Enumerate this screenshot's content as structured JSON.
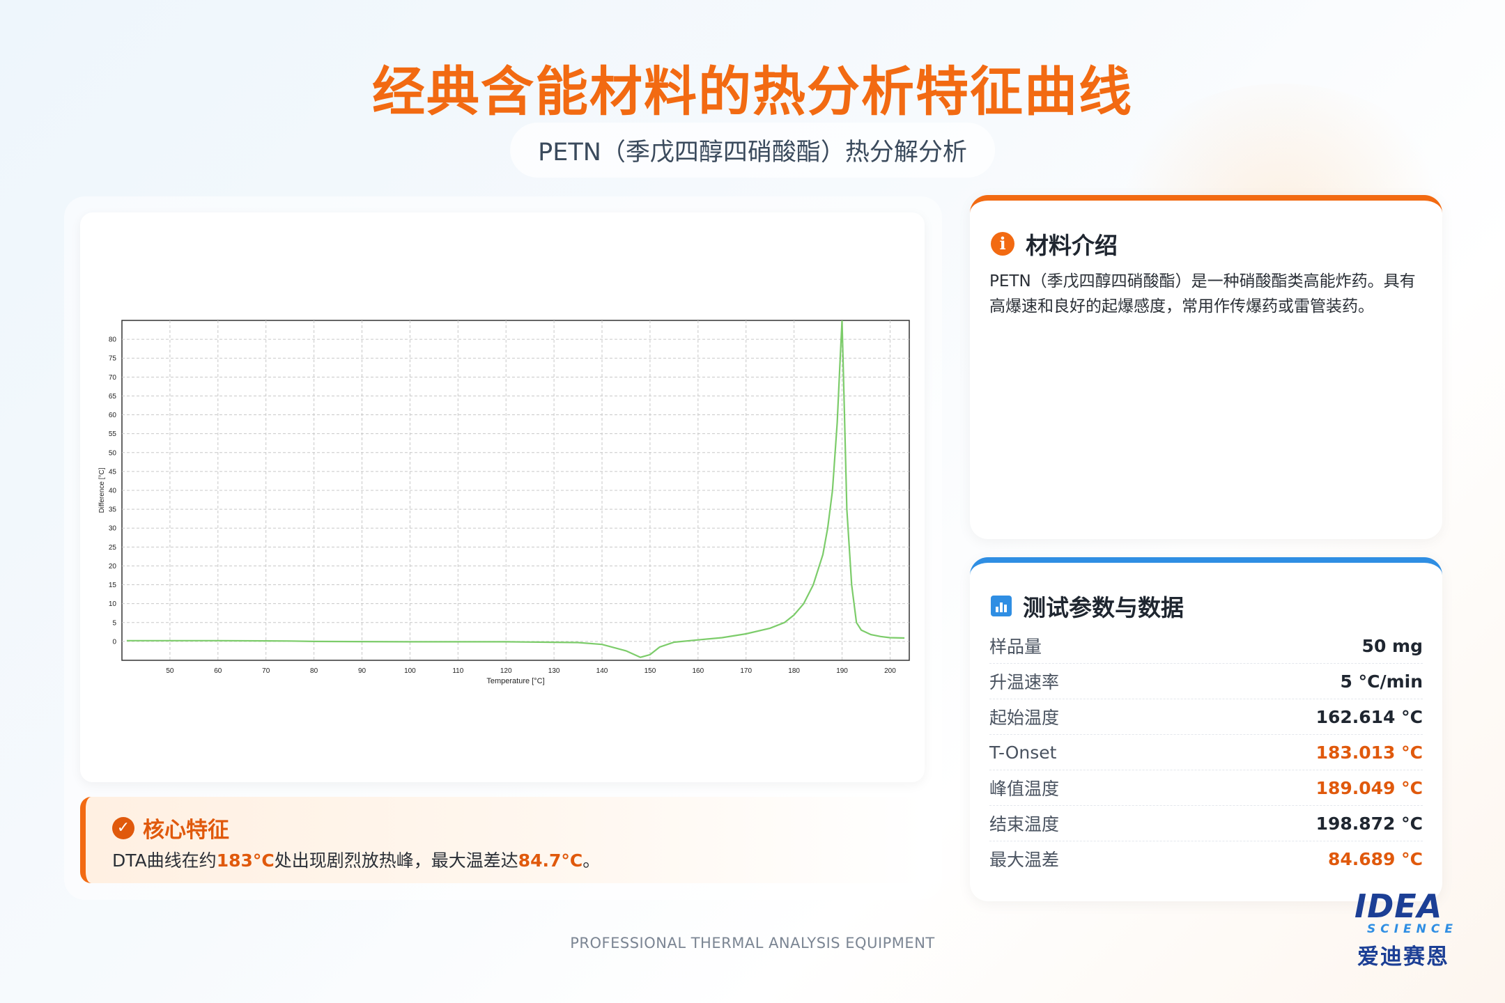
{
  "header": {
    "title": "经典含能材料的热分析特征曲线",
    "subtitle": "PETN（季戊四醇四硝酸酯）热分解分析"
  },
  "chart_data": {
    "type": "line",
    "xlabel": "Temperature [°C]",
    "ylabel": "Difference [°C]",
    "xlim": [
      40,
      204
    ],
    "ylim": [
      -5,
      85
    ],
    "xticks": [
      50,
      60,
      70,
      80,
      90,
      100,
      110,
      120,
      130,
      140,
      150,
      160,
      170,
      180,
      190,
      200
    ],
    "yticks": [
      0,
      5,
      10,
      15,
      20,
      25,
      30,
      35,
      40,
      45,
      50,
      55,
      60,
      65,
      70,
      75,
      80
    ],
    "grid": true,
    "line_color": "#7ccc6a",
    "series": [
      {
        "x": [
          41,
          60,
          75,
          80,
          100,
          120,
          135,
          140,
          145,
          148,
          150,
          152,
          155,
          160,
          165,
          170,
          175,
          178,
          180,
          182,
          184,
          186,
          187,
          188,
          189,
          189.5,
          190,
          190.5,
          191,
          192,
          193,
          194,
          196,
          198,
          200,
          203
        ],
        "y": [
          0.2,
          0.2,
          0.1,
          0,
          -0.1,
          -0.1,
          -0.3,
          -0.8,
          -2.5,
          -4.2,
          -3.5,
          -1.5,
          -0.2,
          0.4,
          1,
          2,
          3.5,
          5,
          7,
          10,
          15,
          23,
          30,
          40,
          58,
          72,
          85,
          60,
          35,
          15,
          5,
          3,
          1.8,
          1.3,
          1,
          0.9
        ]
      }
    ]
  },
  "feature": {
    "title": "核心特征",
    "text_before": "DTA曲线在约",
    "temp": "183°C",
    "text_middle": "处出现剧烈放热峰，最大温差达",
    "diff": "84.7°C",
    "text_after": "。"
  },
  "material": {
    "title": "材料介绍",
    "description": "PETN（季戊四醇四硝酸酯）是一种硝酸酯类高能炸药。具有高爆速和良好的起爆感度，常用作传爆药或雷管装药。"
  },
  "params": {
    "title": "测试参数与数据",
    "rows": [
      {
        "label": "样品量",
        "value": "50 mg",
        "accent": false
      },
      {
        "label": "升温速率",
        "value": "5 °C/min",
        "accent": false
      },
      {
        "label": "起始温度",
        "value": "162.614 °C",
        "accent": false
      },
      {
        "label": "T-Onset",
        "value": "183.013 °C",
        "accent": true
      },
      {
        "label": "峰值温度",
        "value": "189.049 °C",
        "accent": true
      },
      {
        "label": "结束温度",
        "value": "198.872 °C",
        "accent": false
      },
      {
        "label": "最大温差",
        "value": "84.689 °C",
        "accent": true
      }
    ]
  },
  "footer": {
    "text": "PROFESSIONAL THERMAL ANALYSIS EQUIPMENT"
  },
  "logo": {
    "main": "IDEA",
    "sub": "SCIENCE",
    "cn": "爱迪赛恩"
  },
  "colors": {
    "accent_orange": "#f26a12",
    "accent_blue": "#2f8ee3",
    "brand_navy": "#1c3f95"
  },
  "icons": {
    "feature": "verified-badge-icon",
    "material": "info-icon",
    "params": "bar-chart-icon"
  }
}
